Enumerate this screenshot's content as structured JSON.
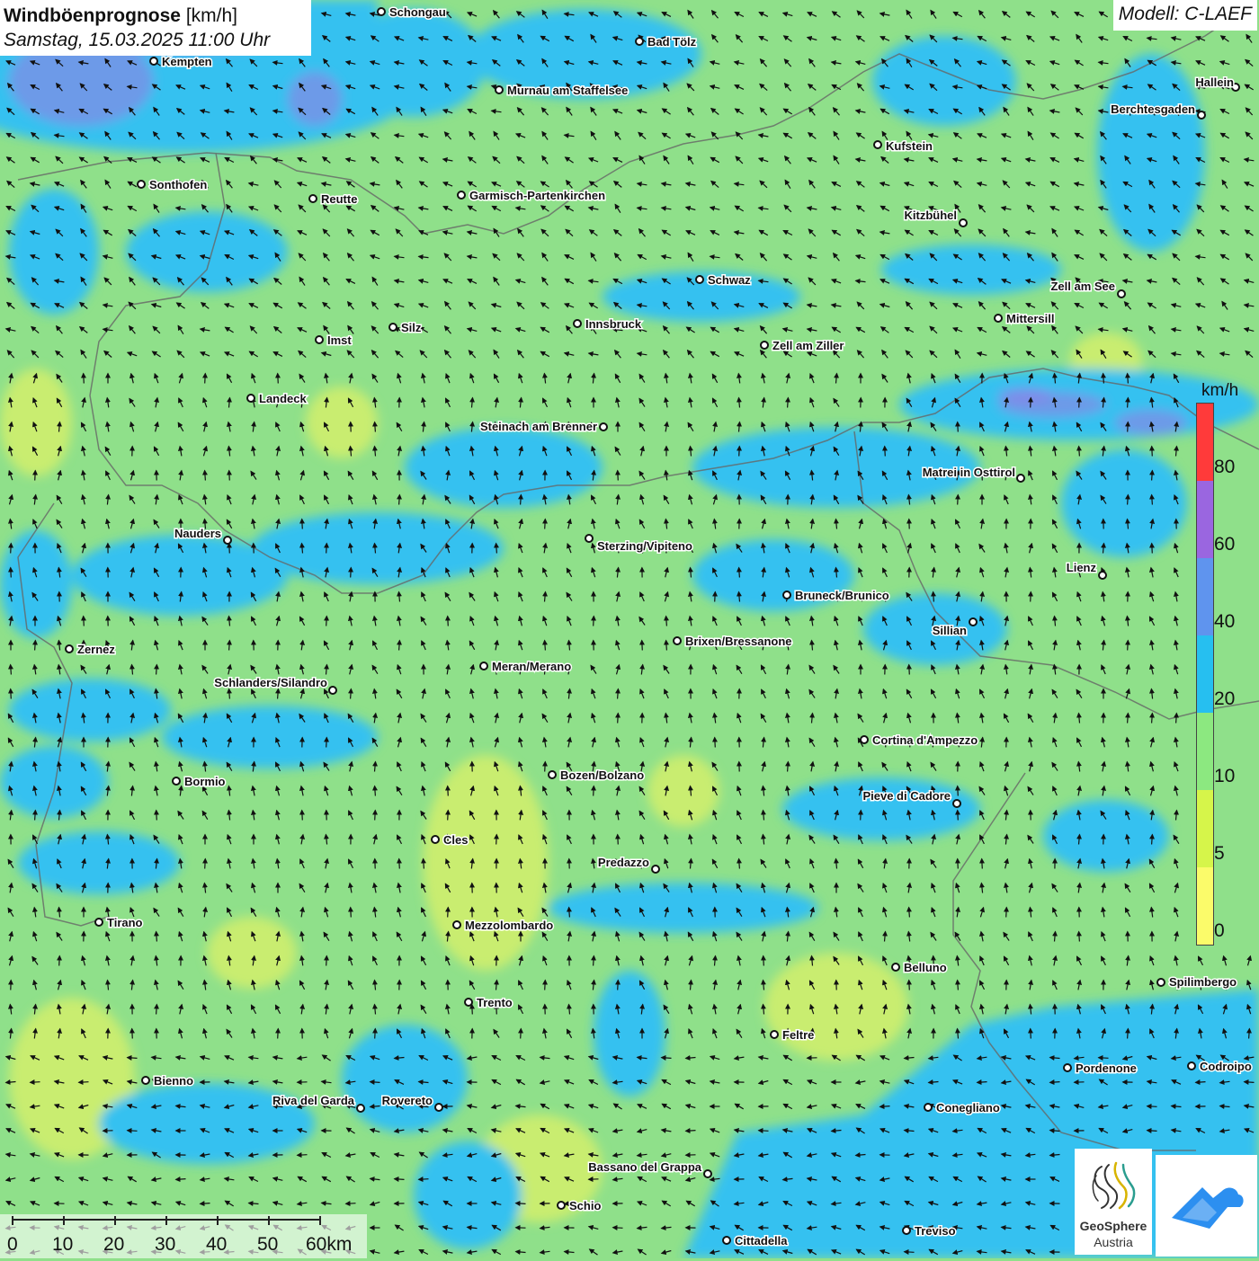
{
  "header": {
    "title_bold": "Windböenprognose",
    "title_unit": "[km/h]",
    "datetime": "Samstag, 15.03.2025 11:00 Uhr",
    "model": "Modell: C-LAEF"
  },
  "legend": {
    "unit": "km/h",
    "bands": [
      {
        "color": "#ff3a3a"
      },
      {
        "color": "#9a66e0"
      },
      {
        "color": "#5f94ee"
      },
      {
        "color": "#26bff0"
      },
      {
        "color": "#8ce880"
      },
      {
        "color": "#d6f54a"
      },
      {
        "color": "#fbfb6a"
      }
    ],
    "labels": [
      "80",
      "60",
      "40",
      "20",
      "10",
      "5",
      "0"
    ]
  },
  "scalebar": {
    "labels": [
      "0",
      "10",
      "20",
      "30",
      "40",
      "50",
      "60km"
    ]
  },
  "logo": {
    "name": "GeoSphere",
    "country": "Austria"
  },
  "colors": {
    "calm_yellow": "#e8f26a",
    "light_green": "#8fe08a",
    "blue": "#36c1f0",
    "deep_blue": "#5f94ee",
    "purple": "#8f7ee8",
    "border": "#666666",
    "brand_blue": "#2c8ff0"
  },
  "cities": [
    "Schongau",
    "Bad Tölz",
    "Kempten",
    "Murnau am Staffelsee",
    "Hallein",
    "Berchtesgaden",
    "Kufstein",
    "Sonthofen",
    "Reutte",
    "Garmisch-Partenkirchen",
    "Kitzbühel",
    "Schwaz",
    "Zell am See",
    "Innsbruck",
    "Mittersill",
    "Imst",
    "Silz",
    "Zell am Ziller",
    "Landeck",
    "Steinach am Brenner",
    "Matrei in Osttirol",
    "Nauders",
    "Sterzing/Vipiteno",
    "Lienz",
    "Bruneck/Brunico",
    "Sillian",
    "Zernez",
    "Brixen/Bressanone",
    "Meran/Merano",
    "Schlanders/Silandro",
    "Cortina d'Ampezzo",
    "Bormio",
    "Bozen/Bolzano",
    "Pieve di Cadore",
    "Cles",
    "Predazzo",
    "Tirano",
    "Mezzolombardo",
    "Belluno",
    "Spilimbergo",
    "Trento",
    "Feltre",
    "Pordenone",
    "Codroipo",
    "Bienno",
    "Riva del Garda",
    "Rovereto",
    "Conegliano",
    "Bassano del Grappa",
    "Schio",
    "Treviso",
    "Cittadella"
  ]
}
